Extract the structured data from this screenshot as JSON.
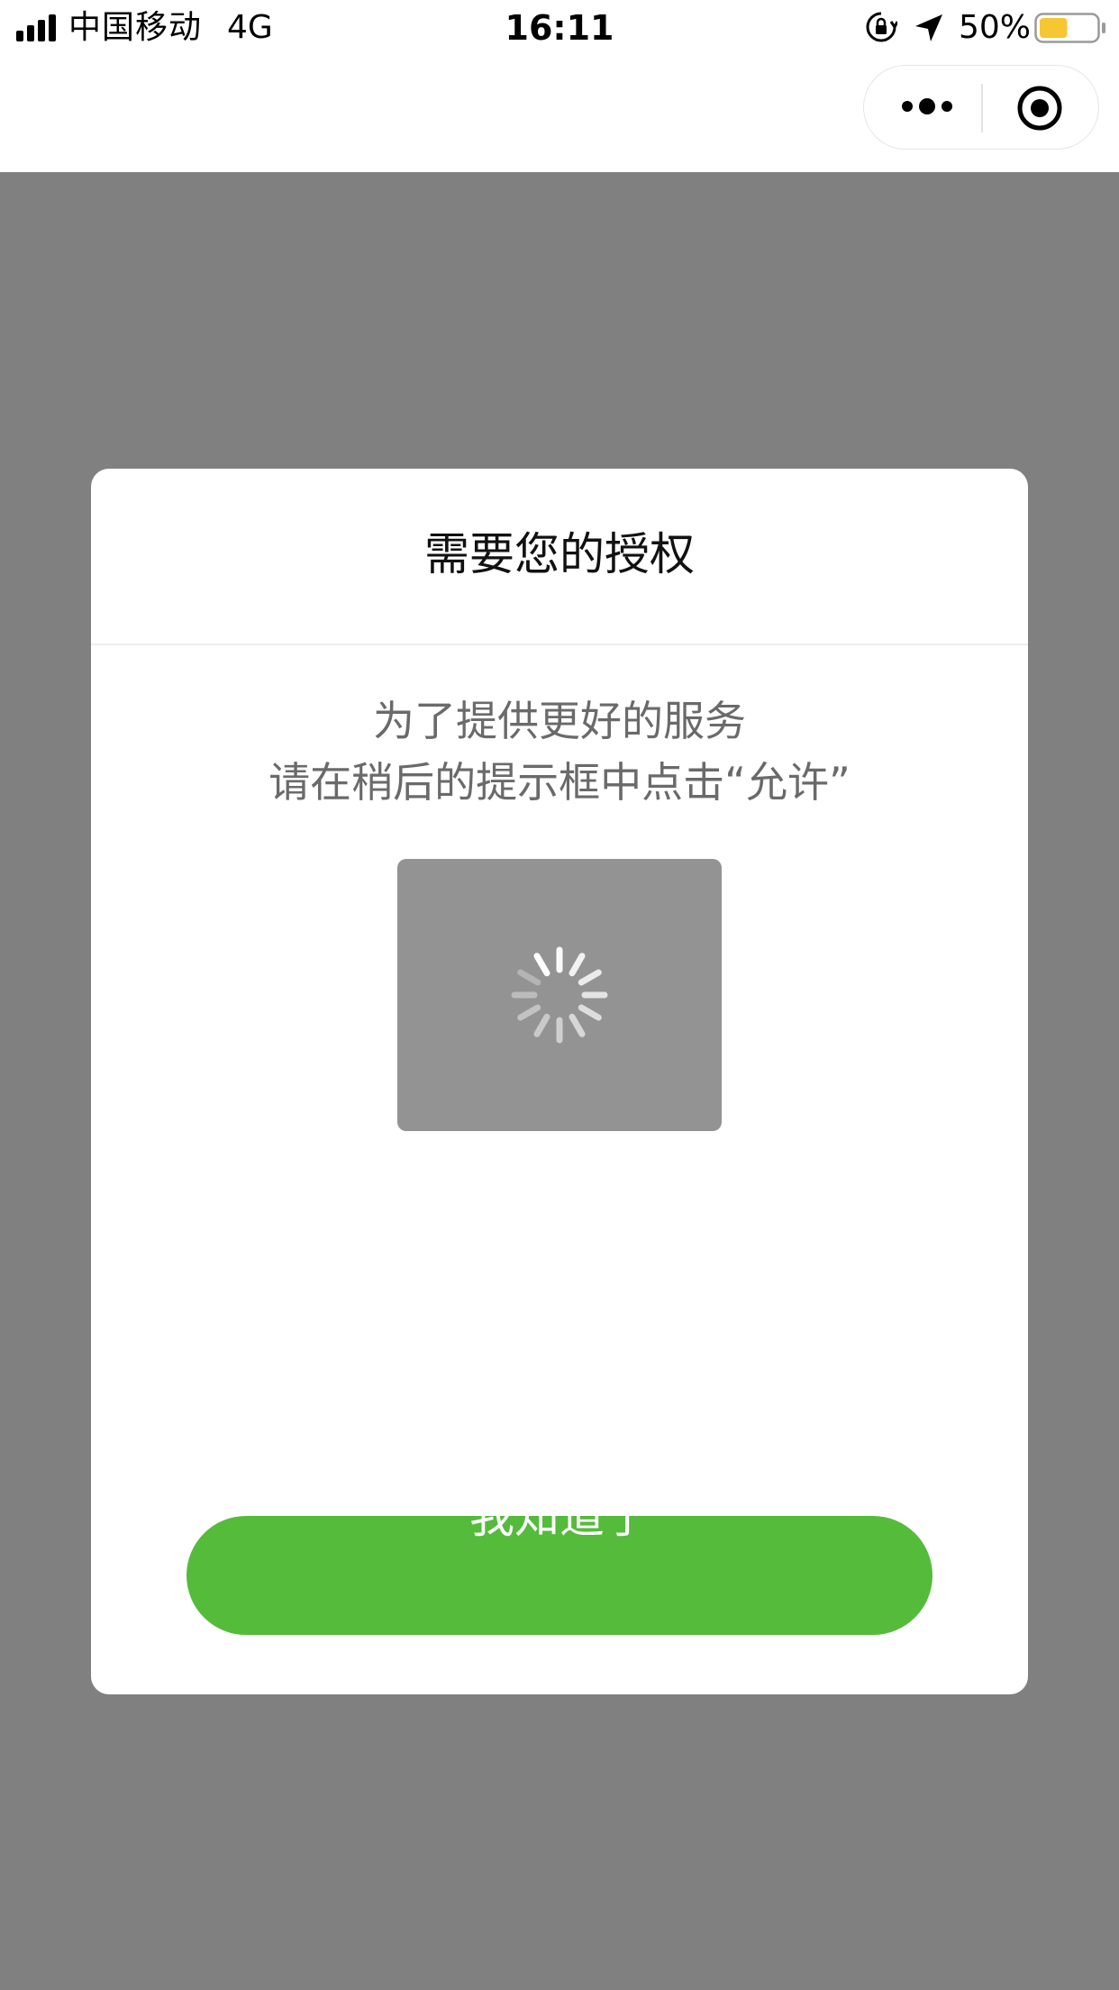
{
  "status_bar": {
    "carrier": "中国移动",
    "network": "4G",
    "time": "16:11",
    "battery_percent": "50%",
    "battery_level": 0.5,
    "battery_color": "#f7c633",
    "icons": [
      "signal-bars-icon",
      "rotation-lock-icon",
      "location-arrow-icon",
      "battery-icon"
    ]
  },
  "capsule": {
    "icons": [
      "more-dots-icon",
      "close-target-icon"
    ]
  },
  "modal": {
    "title": "需要您的授权",
    "line1": "为了提供更好的服务",
    "line2": "请在稍后的提示框中点击“允许”",
    "button_label": "我知道了",
    "button_color": "#55bb3b",
    "loading_icon": "spinner-icon"
  },
  "overlay_color": "#808080"
}
